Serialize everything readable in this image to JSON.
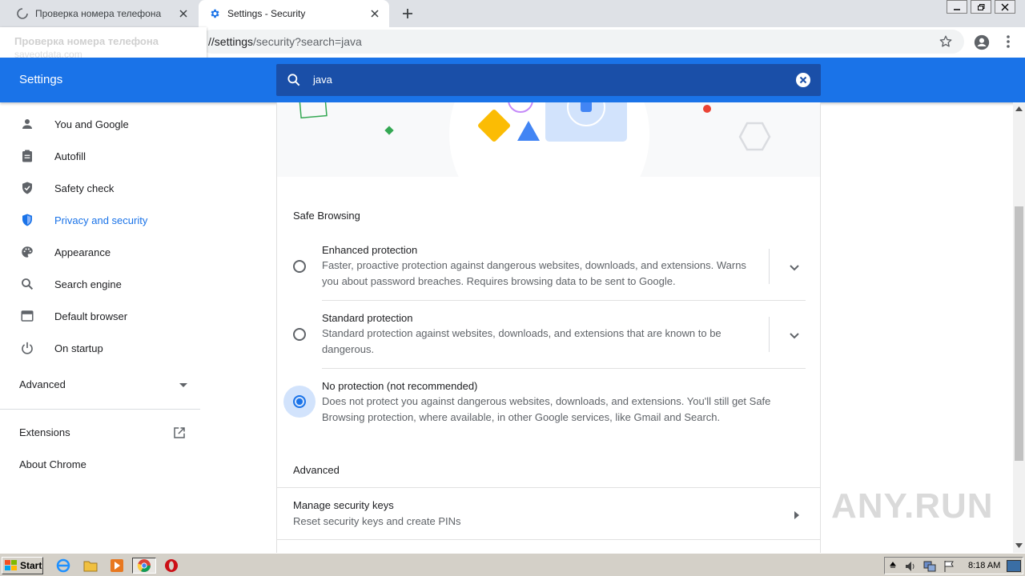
{
  "browser": {
    "tabs": [
      {
        "title": "Проверка номера телефона",
        "active": false,
        "loading": true
      },
      {
        "title": "Settings - Security",
        "active": true
      }
    ],
    "address": {
      "prefix": "//settings",
      "path": "/security?search=java"
    },
    "hover_card": {
      "title": "Проверка номера телефона",
      "url": "saveotdata.com"
    }
  },
  "settings": {
    "title": "Settings",
    "search_value": "java",
    "nav": [
      {
        "label": "You and Google",
        "icon": "person-icon"
      },
      {
        "label": "Autofill",
        "icon": "clipboard-icon"
      },
      {
        "label": "Safety check",
        "icon": "shield-check-icon"
      },
      {
        "label": "Privacy and security",
        "icon": "shield-icon",
        "selected": true
      },
      {
        "label": "Appearance",
        "icon": "palette-icon"
      },
      {
        "label": "Search engine",
        "icon": "search-icon"
      },
      {
        "label": "Default browser",
        "icon": "browser-icon"
      },
      {
        "label": "On startup",
        "icon": "power-icon"
      }
    ],
    "advanced": "Advanced",
    "extensions": "Extensions",
    "about": "About Chrome"
  },
  "main": {
    "section_safe_browsing": "Safe Browsing",
    "options": [
      {
        "title": "Enhanced protection",
        "desc": "Faster, proactive protection against dangerous websites, downloads, and extensions. Warns you about password breaches. Requires browsing data to be sent to Google.",
        "checked": false
      },
      {
        "title": "Standard protection",
        "desc": "Standard protection against websites, downloads, and extensions that are known to be dangerous.",
        "checked": false
      },
      {
        "title": "No protection (not recommended)",
        "desc": "Does not protect you against dangerous websites, downloads, and extensions. You'll still get Safe Browsing protection, where available, in other Google services, like Gmail and Search.",
        "checked": true
      }
    ],
    "section_advanced": "Advanced",
    "security_keys": {
      "title": "Manage security keys",
      "sub": "Reset security keys and create PINs"
    }
  },
  "watermark": "ANY.RUN",
  "taskbar": {
    "start": "Start",
    "clock": "8:18 AM"
  },
  "colors": {
    "accent": "#1a73e8",
    "header": "#1a73e8",
    "search_bg": "#1a4fa8"
  }
}
